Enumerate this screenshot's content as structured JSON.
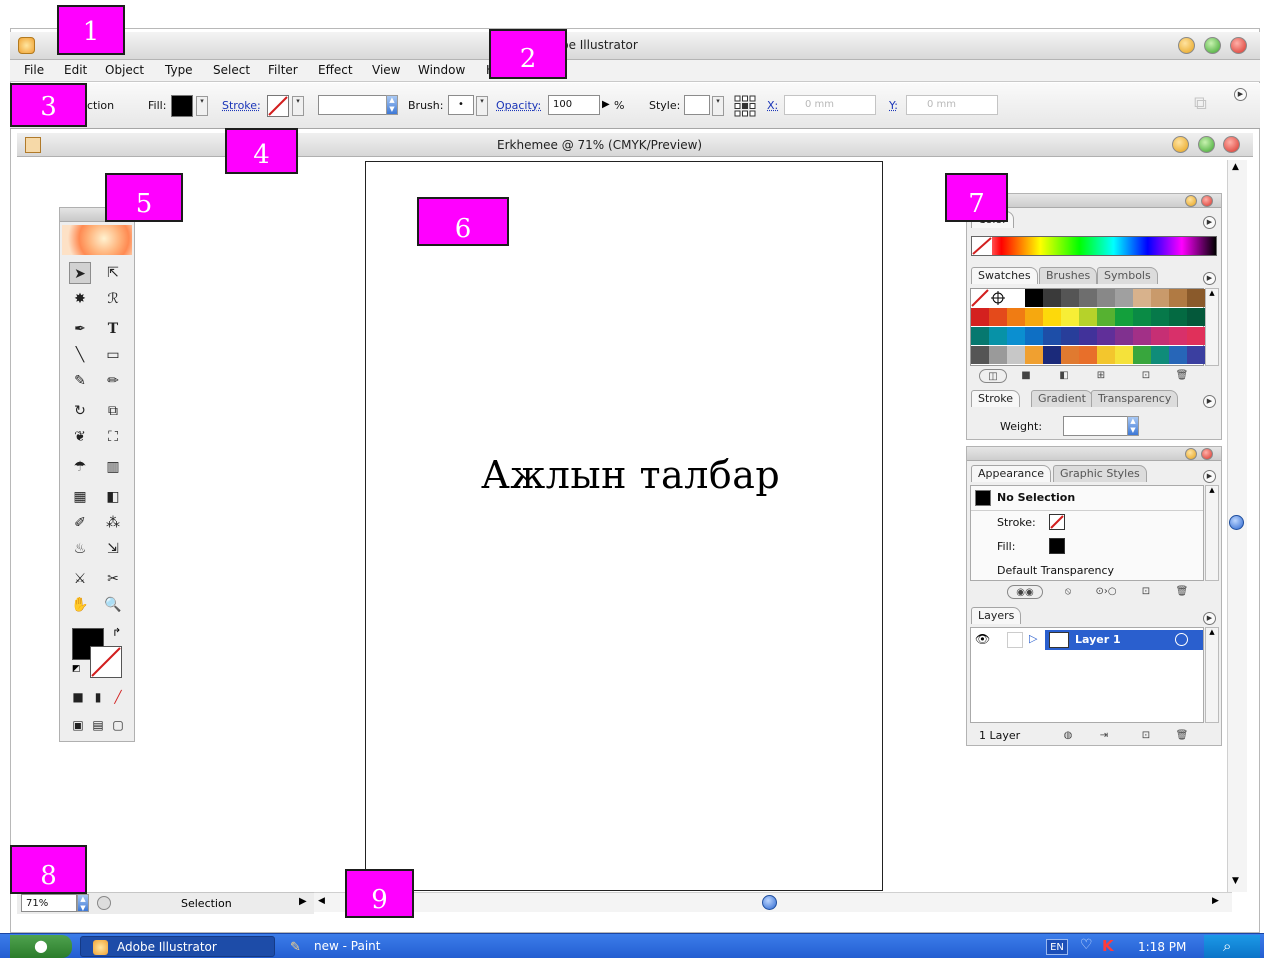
{
  "app": {
    "title": "Adobe Illustrator",
    "menu": [
      "File",
      "Edit",
      "Object",
      "Type",
      "Select",
      "Filter",
      "Effect",
      "View",
      "Window",
      "H"
    ]
  },
  "control_bar": {
    "mode_label": "ction",
    "fill_label": "Fill:",
    "stroke_label": "Stroke:",
    "brush_label": "Brush:",
    "brush_value": "•",
    "opacity_label": "Opacity:",
    "opacity_value": "100",
    "opacity_unit": "%",
    "style_label": "Style:",
    "x_label": "X:",
    "x_value": "0 mm",
    "y_label": "Y:",
    "y_value": "0 mm"
  },
  "document": {
    "title": "Erkhemee @ 71% (CMYK/Preview)",
    "artboard_text": "Ажлын талбар"
  },
  "statusbar": {
    "zoom": "71%",
    "status": "Selection"
  },
  "panels": {
    "color": {
      "tab": "Color"
    },
    "swatches": {
      "tabs": [
        "Swatches",
        "Brushes",
        "Symbols"
      ]
    },
    "stroke": {
      "tabs": [
        "Stroke",
        "Gradient",
        "Transparency"
      ],
      "weight_label": "Weight:"
    },
    "appearance": {
      "tabs": [
        "Appearance",
        "Graphic Styles"
      ],
      "rows": [
        "No Selection",
        "Stroke:",
        "Fill:",
        "Default Transparency"
      ]
    },
    "layers": {
      "tab": "Layers",
      "layer_name": "Layer 1",
      "footer": "1 Layer"
    }
  },
  "taskbar": {
    "apps": [
      "Adobe Illustrator",
      "new - Paint"
    ],
    "lang": "EN",
    "time": "1:18 PM"
  },
  "callouts": [
    "1",
    "2",
    "3",
    "4",
    "5",
    "6",
    "7",
    "8",
    "9"
  ],
  "colors": {
    "callout": "#ff00ff",
    "taskbar": "#245ed1",
    "selection_blue": "#2a5fce"
  }
}
